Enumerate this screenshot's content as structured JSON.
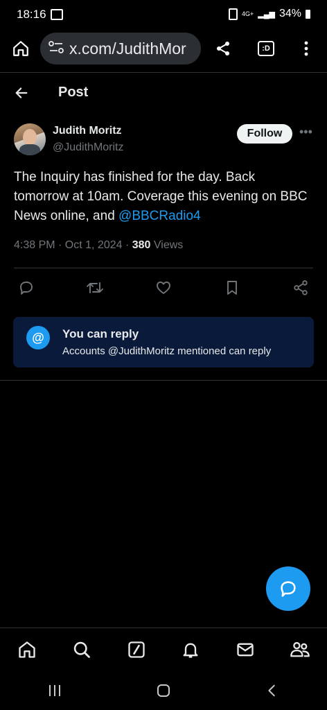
{
  "status": {
    "time": "18:16",
    "network": "4G+",
    "battery": "34%"
  },
  "browser": {
    "url": "x.com/JudithMor"
  },
  "header": {
    "title": "Post"
  },
  "post": {
    "author_name": "Judith Moritz",
    "author_handle": "@JudithMoritz",
    "follow_label": "Follow",
    "text_main": "The Inquiry has finished for the day. Back tomorrow at 10am. Coverage this evening on BBC News online, and ",
    "text_mention": "@BBCRadio4",
    "timestamp": "4:38 PM · Oct 1, 2024 · ",
    "views_count": "380",
    "views_label": " Views"
  },
  "reply_info": {
    "title": "You can reply",
    "subtitle": "Accounts @JudithMoritz mentioned can reply"
  },
  "colors": {
    "accent": "#1d9bf0",
    "background": "#000000",
    "reply_box": "#0a1a3a"
  },
  "icons": {
    "actions": [
      "reply-icon",
      "repost-icon",
      "like-icon",
      "bookmark-icon",
      "share-icon"
    ],
    "tabs": [
      "home-icon",
      "search-icon",
      "grok-icon",
      "notifications-icon",
      "messages-icon",
      "communities-icon"
    ]
  }
}
